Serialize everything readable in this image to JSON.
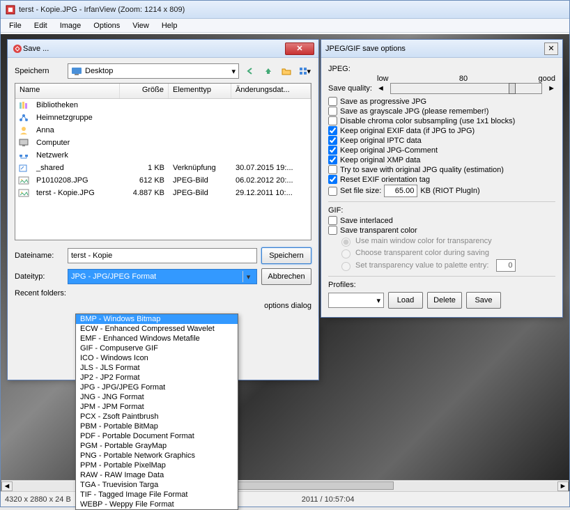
{
  "main": {
    "title": "terst - Kopie.JPG - IrfanView (Zoom: 1214 x 809)",
    "menu": [
      "File",
      "Edit",
      "Image",
      "Options",
      "View",
      "Help"
    ],
    "status": {
      "dims": "4320 x 2880 x 24 B",
      "date": "2011 / 10:57:04"
    }
  },
  "save": {
    "title": "Save ...",
    "location_label": "Speichern",
    "location_value": "Desktop",
    "cols": {
      "name": "Name",
      "size": "Größe",
      "type": "Elementtyp",
      "date": "Änderungsdat..."
    },
    "rows": [
      {
        "icon": "lib",
        "name": "Bibliotheken",
        "size": "",
        "type": "",
        "date": ""
      },
      {
        "icon": "net",
        "name": "Heimnetzgruppe",
        "size": "",
        "type": "",
        "date": ""
      },
      {
        "icon": "user",
        "name": "Anna",
        "size": "",
        "type": "",
        "date": ""
      },
      {
        "icon": "pc",
        "name": "Computer",
        "size": "",
        "type": "",
        "date": ""
      },
      {
        "icon": "net2",
        "name": "Netzwerk",
        "size": "",
        "type": "",
        "date": ""
      },
      {
        "icon": "link",
        "name": "_shared",
        "size": "1 KB",
        "type": "Verknüpfung",
        "date": "30.07.2015 19:..."
      },
      {
        "icon": "img",
        "name": "P1010208.JPG",
        "size": "612 KB",
        "type": "JPEG-Bild",
        "date": "06.02.2012 20:..."
      },
      {
        "icon": "img",
        "name": "terst - Kopie.JPG",
        "size": "4.887 KB",
        "type": "JPEG-Bild",
        "date": "29.12.2011 10:..."
      }
    ],
    "filename_label": "Dateiname:",
    "filename_value": "terst - Kopie",
    "filetype_label": "Dateityp:",
    "filetype_value": "JPG - JPG/JPEG Format",
    "recent_label": "Recent folders:",
    "save_btn": "Speichern",
    "cancel_btn": "Abbrechen",
    "show_opts": "options dialog",
    "formats": [
      "BMP - Windows Bitmap",
      "ECW - Enhanced Compressed Wavelet",
      "EMF - Enhanced Windows Metafile",
      "GIF - Compuserve GIF",
      "ICO - Windows Icon",
      "JLS - JLS Format",
      "JP2 - JP2 Format",
      "JPG - JPG/JPEG Format",
      "JNG - JNG Format",
      "JPM - JPM Format",
      "PCX - Zsoft Paintbrush",
      "PBM - Portable BitMap",
      "PDF - Portable Document Format",
      "PGM - Portable GrayMap",
      "PNG - Portable Network Graphics",
      "PPM - Portable PixelMap",
      "RAW - RAW Image Data",
      "TGA - Truevision Targa",
      "TIF - Tagged Image File Format",
      "WEBP - Weppy File Format"
    ],
    "format_highlight": 0
  },
  "opts": {
    "title": "JPEG/GIF save options",
    "jpeg_label": "JPEG:",
    "quality_label": "Save quality:",
    "quality_low": "low",
    "quality_val": "80",
    "quality_good": "good",
    "checks": [
      {
        "label": "Save as progressive JPG",
        "checked": false
      },
      {
        "label": "Save as grayscale JPG (please remember!)",
        "checked": false
      },
      {
        "label": "Disable chroma color subsampling (use 1x1 blocks)",
        "checked": false
      },
      {
        "label": "Keep original EXIF data (if JPG to JPG)",
        "checked": true
      },
      {
        "label": "Keep original IPTC data",
        "checked": true
      },
      {
        "label": "Keep original JPG-Comment",
        "checked": true
      },
      {
        "label": "Keep original XMP data",
        "checked": true
      },
      {
        "label": "Try to save with original JPG quality (estimation)",
        "checked": false
      },
      {
        "label": "Reset EXIF orientation tag",
        "checked": true
      }
    ],
    "filesize_label": "Set file size:",
    "filesize_val": "65.00",
    "filesize_unit": "KB (RIOT PlugIn)",
    "gif_label": "GIF:",
    "gif_interlaced": "Save interlaced",
    "gif_transparent": "Save transparent color",
    "radios": [
      "Use main window color for transparency",
      "Choose transparent color during saving",
      "Set transparency value to palette entry:"
    ],
    "palette_val": "0",
    "profiles_label": "Profiles:",
    "load_btn": "Load",
    "delete_btn": "Delete",
    "save_btn": "Save"
  }
}
